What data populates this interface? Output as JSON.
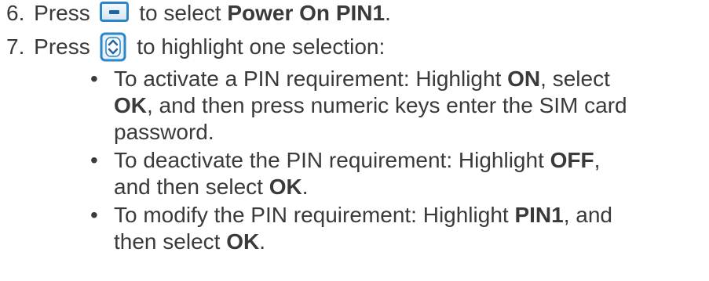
{
  "step6": {
    "number": "6.",
    "before": "Press",
    "after": "to select",
    "target": "Power On PIN1",
    "end": "."
  },
  "step7": {
    "number": "7.",
    "before": "Press",
    "after": "to highlight one selection:"
  },
  "bullets": [
    {
      "b1": "To activate a PIN requirement: Highlight",
      "b1_strong": "ON",
      "b2": ", select",
      "line2_strong": "OK",
      "line2_rest": ", and then press numeric keys enter the SIM card",
      "line3": "password."
    },
    {
      "b1": "To deactivate the PIN requirement: Highlight",
      "b1_strong": "OFF",
      "b2": ",",
      "line2_pre": "and then select",
      "line2_strong": "OK",
      "line2_end": "."
    },
    {
      "b1": "To modify the PIN requirement: Highlight",
      "b1_strong": "PIN1",
      "b2": ", and",
      "line2_pre": "then select",
      "line2_strong": "OK",
      "line2_end": "."
    }
  ],
  "bullet_glyph": "•",
  "icons": {
    "softkey": "left-softkey-icon",
    "nav": "navigation-key-icon"
  },
  "colors": {
    "text": "#3a3a3a",
    "icon_border": "#2a86c9",
    "icon_accent": "#1b66a8"
  }
}
